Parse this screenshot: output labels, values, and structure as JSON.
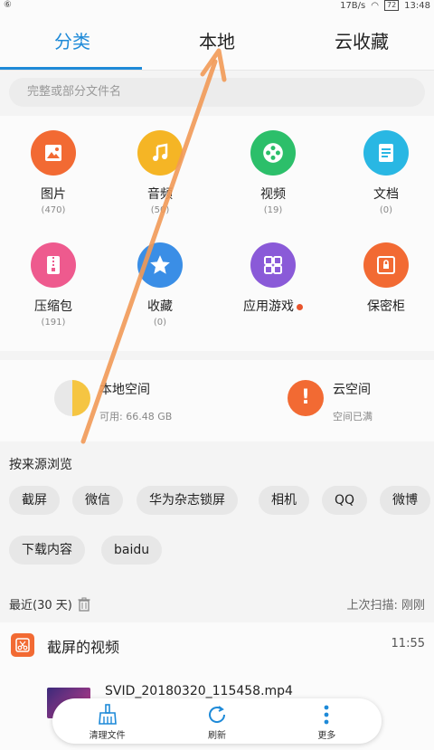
{
  "status": {
    "left": "⑥",
    "speed": "17B/s",
    "battery": "72",
    "time": "13:48"
  },
  "tabs": [
    {
      "label": "分类",
      "active": true
    },
    {
      "label": "本地",
      "active": false
    },
    {
      "label": "云收藏",
      "active": false
    }
  ],
  "search": {
    "placeholder": "完整或部分文件名"
  },
  "categories": [
    {
      "label": "图片",
      "count": "(470)",
      "color": "#f26a33",
      "icon": "image-icon"
    },
    {
      "label": "音频",
      "count": "(50)",
      "color": "#f5b525",
      "icon": "music-icon"
    },
    {
      "label": "视频",
      "count": "(19)",
      "color": "#2cbf6a",
      "icon": "video-reel-icon"
    },
    {
      "label": "文档",
      "count": "(0)",
      "color": "#29b7e3",
      "icon": "document-icon"
    },
    {
      "label": "压缩包",
      "count": "(191)",
      "color": "#ee5a8e",
      "icon": "zip-icon"
    },
    {
      "label": "收藏",
      "count": "(0)",
      "color": "#3a8ee6",
      "icon": "star-icon"
    },
    {
      "label": "应用游戏",
      "count": "",
      "color": "#8a5ad8",
      "icon": "apps-grid-icon"
    },
    {
      "label": "保密柜",
      "count": "",
      "color": "#f26a33",
      "icon": "safe-icon"
    }
  ],
  "storage": {
    "local_title": "本地空间",
    "local_sub": "可用: 66.48 GB",
    "cloud_title": "云空间",
    "cloud_sub": "空间已满",
    "cloud_mark": "!"
  },
  "source": {
    "title": "按来源浏览",
    "chips": [
      "截屏",
      "微信",
      "华为杂志锁屏",
      "相机",
      "QQ",
      "微博",
      "下载内容",
      "baidu"
    ]
  },
  "recent": {
    "label": "最近(30 天)",
    "scan": "上次扫描: 刚刚"
  },
  "list": {
    "row_title": "截屏的视频",
    "row_time": "11:55",
    "file_name": "SVID_20180320_115458.mp4"
  },
  "bottom": [
    {
      "label": "清理文件",
      "icon": "broom-icon"
    },
    {
      "label": "刷新",
      "icon": "refresh-icon"
    },
    {
      "label": "更多",
      "icon": "more-vertical-icon"
    }
  ],
  "colors": {
    "accent": "#1e8ad8",
    "orange": "#f26a33"
  }
}
